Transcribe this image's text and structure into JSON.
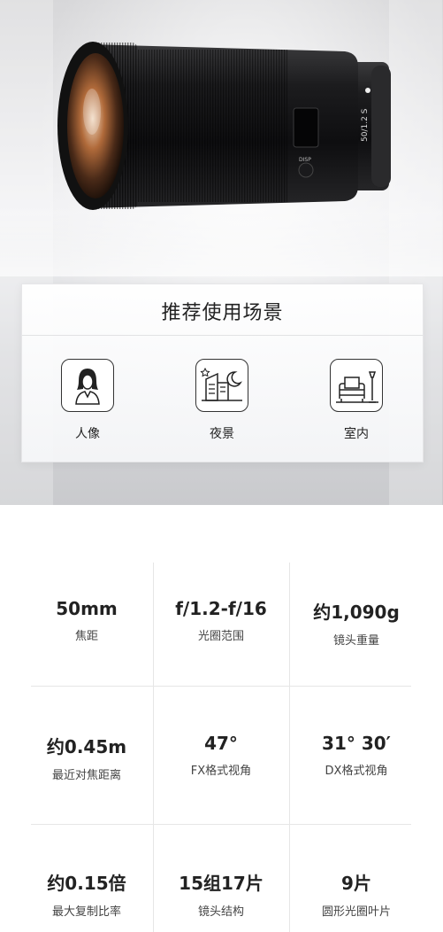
{
  "lens_marking": "50/1.2 S",
  "lens_button_label": "DISP",
  "recommend": {
    "title": "推荐使用场景",
    "scenes": [
      {
        "label": "人像",
        "icon": "portrait-icon"
      },
      {
        "label": "夜景",
        "icon": "night-scene-icon"
      },
      {
        "label": "室内",
        "icon": "indoor-icon"
      }
    ]
  },
  "specs": [
    {
      "value": "50mm",
      "label": "焦距"
    },
    {
      "value": "f/1.2-f/16",
      "label": "光圈范围"
    },
    {
      "value": "约1,090g",
      "label": "镜头重量"
    },
    {
      "value": "约0.45m",
      "label": "最近对焦距离"
    },
    {
      "value": "47°",
      "label": "FX格式视角"
    },
    {
      "value": "31° 30′",
      "label": "DX格式视角"
    },
    {
      "value": "约0.15倍",
      "label": "最大复制比率"
    },
    {
      "value": "15组17片",
      "label": "镜头结构"
    },
    {
      "value": "9片",
      "label": "圆形光圈叶片"
    }
  ]
}
